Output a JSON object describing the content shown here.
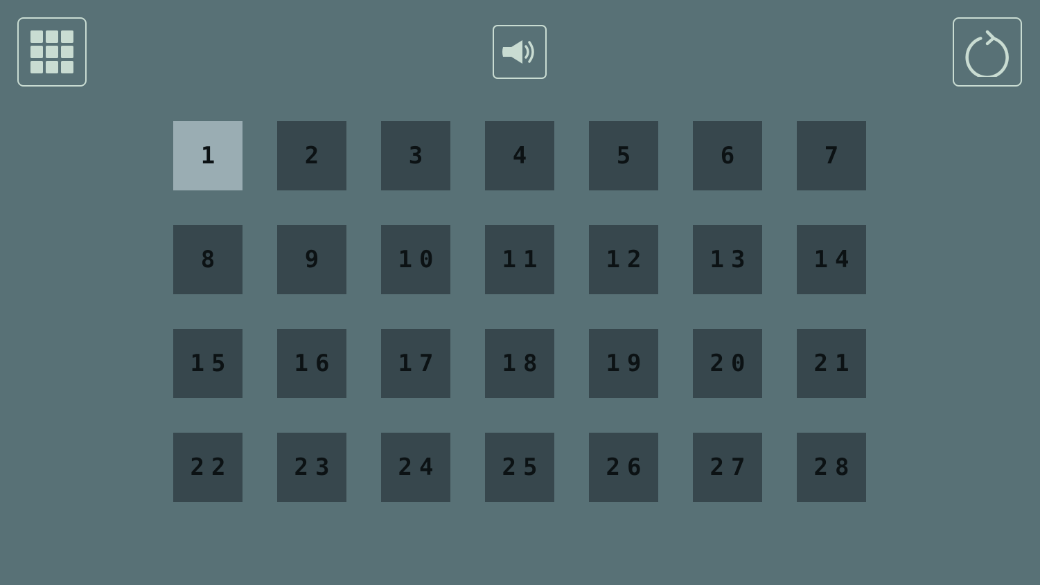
{
  "toolbar": {
    "menu_icon": "grid-menu-icon",
    "sound_icon": "speaker-icon",
    "restart_icon": "restart-icon"
  },
  "colors": {
    "background": "#587176",
    "tile": "#37474d",
    "tile_current": "#9aadb3",
    "icon": "#c9dcd2",
    "tile_text": "#0c1214"
  },
  "levels": [
    {
      "label": "1",
      "current": true
    },
    {
      "label": "2"
    },
    {
      "label": "3"
    },
    {
      "label": "4"
    },
    {
      "label": "5"
    },
    {
      "label": "6"
    },
    {
      "label": "7"
    },
    {
      "label": "8"
    },
    {
      "label": "9"
    },
    {
      "label": "10"
    },
    {
      "label": "11"
    },
    {
      "label": "12"
    },
    {
      "label": "13"
    },
    {
      "label": "14"
    },
    {
      "label": "15"
    },
    {
      "label": "16"
    },
    {
      "label": "17"
    },
    {
      "label": "18"
    },
    {
      "label": "19"
    },
    {
      "label": "20"
    },
    {
      "label": "21"
    },
    {
      "label": "22"
    },
    {
      "label": "23"
    },
    {
      "label": "24"
    },
    {
      "label": "25"
    },
    {
      "label": "26"
    },
    {
      "label": "27"
    },
    {
      "label": "28"
    }
  ]
}
